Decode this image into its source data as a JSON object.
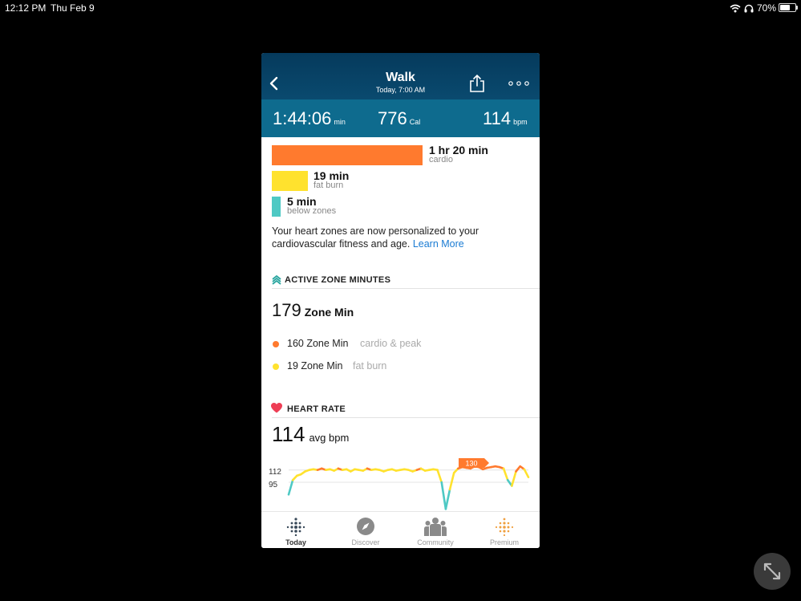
{
  "statusbar": {
    "time": "12:12 PM",
    "date": "Thu Feb 9",
    "battery": "70%",
    "battery_level": 0.7
  },
  "header": {
    "title": "Walk",
    "subtitle": "Today, 7:00 AM"
  },
  "stats": {
    "duration": "1:44:06",
    "duration_unit": "min",
    "calories": "776",
    "calories_unit": "Cal",
    "heart_rate": "114",
    "heart_rate_unit": "bpm"
  },
  "zones": [
    {
      "value": "1 hr 20 min",
      "label": "cardio",
      "color": "#ff7a2e"
    },
    {
      "value": "19 min",
      "label": "fat burn",
      "color": "#ffe22e"
    },
    {
      "value": "5 min",
      "label": "below zones",
      "color": "#4ec9c4"
    }
  ],
  "zone_note": {
    "text": "Your heart zones are now personalized to your cardiovascular fitness and age.",
    "link": "Learn More"
  },
  "active_zone_minutes": {
    "title": "ACTIVE ZONE MINUTES",
    "total": "179",
    "total_unit": "Zone Min",
    "rows": [
      {
        "value": "160 Zone Min",
        "label": "cardio & peak",
        "color": "#ff7a2e"
      },
      {
        "value": "19 Zone Min",
        "label": "fat burn",
        "color": "#ffe22e"
      }
    ]
  },
  "heart_rate": {
    "title": "HEART RATE",
    "avg": "114",
    "avg_unit": "avg bpm",
    "callout": "130",
    "y_labels": [
      "112",
      "95"
    ]
  },
  "chart_data": {
    "type": "line",
    "y_ticks": [
      112,
      95
    ],
    "peak_label": 130,
    "series": [
      {
        "values": [
          78,
          98,
          104,
          106,
          110,
          112,
          113,
          112,
          114,
          112,
          113,
          111,
          114,
          112,
          113,
          110,
          113,
          112,
          111,
          114,
          112,
          113,
          112,
          110,
          112,
          113,
          111,
          112,
          113,
          112,
          110,
          112,
          114,
          111,
          112,
          113,
          112,
          95,
          58,
          85,
          108,
          114,
          116,
          115,
          114,
          117,
          116,
          113,
          115,
          116,
          117,
          116,
          114,
          98,
          90,
          110,
          117,
          113,
          102
        ]
      }
    ],
    "ylim": [
      55,
      135
    ],
    "colors": {
      "cardio": "#ff7a2e",
      "fat_burn": "#ffe22e",
      "below": "#4ec9c4"
    }
  },
  "tabs": [
    {
      "label": "Today",
      "icon": "fitbit-dots-icon",
      "active": true
    },
    {
      "label": "Discover",
      "icon": "compass-icon",
      "active": false
    },
    {
      "label": "Community",
      "icon": "community-icon",
      "active": false
    },
    {
      "label": "Premium",
      "icon": "premium-dots-icon",
      "active": false
    }
  ]
}
